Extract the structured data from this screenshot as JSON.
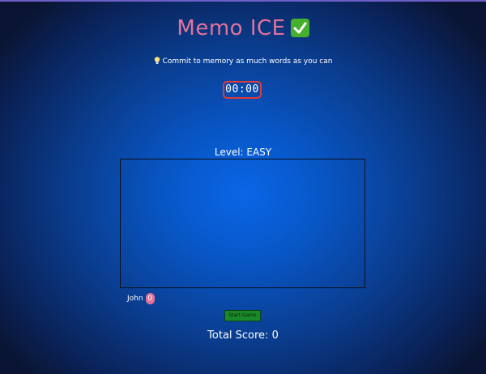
{
  "header": {
    "title": "Memo ICE",
    "title_icon": "check-mark-icon",
    "hint_icon": "lightbulb-icon",
    "hint": "Commit to memory as much words as you can"
  },
  "timer": {
    "value": "00:00"
  },
  "game": {
    "level_text": "Level: EASY"
  },
  "player": {
    "name": "John",
    "score": "0"
  },
  "controls": {
    "start_label": "Start Game"
  },
  "footer": {
    "total_score_text": "Total Score: 0"
  },
  "colors": {
    "title": "#e3739a",
    "timer_border": "#e23a3a",
    "start_button": "#198a2a",
    "background_center": "#0a66e6",
    "background_edge": "#0a1533"
  }
}
